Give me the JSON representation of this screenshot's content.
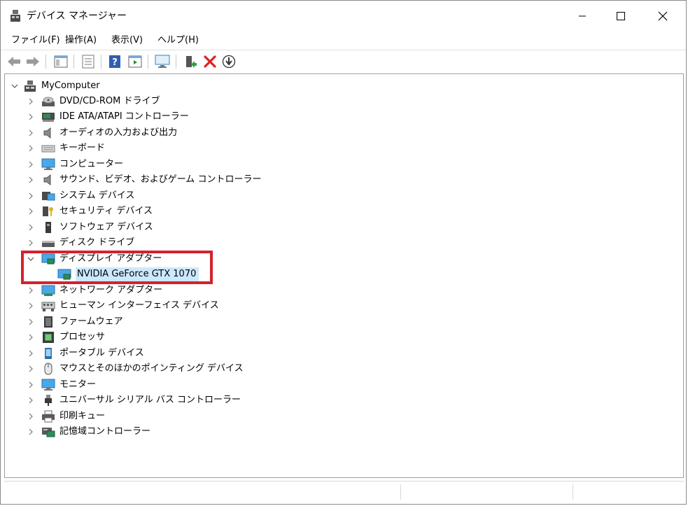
{
  "window": {
    "title": "デバイス マネージャー",
    "controls": {
      "minimize": "minimize",
      "maximize": "maximize",
      "close": "close"
    }
  },
  "menu": [
    {
      "id": "file",
      "label": "ファイル(F)"
    },
    {
      "id": "action",
      "label": "操作(A)"
    },
    {
      "id": "view",
      "label": "表示(V)"
    },
    {
      "id": "help",
      "label": "ヘルプ(H)"
    }
  ],
  "toolbar": [
    "back-arrow-icon",
    "forward-arrow-icon",
    "show-hide-console-tree-icon",
    "properties-icon",
    "help-icon",
    "show-action-pane-icon",
    "scan-hardware-icon",
    "update-driver-icon",
    "uninstall-icon",
    "enable-disable-icon"
  ],
  "tree": {
    "root": "MyComputer",
    "categories": [
      {
        "label": "DVD/CD-ROM ドライブ",
        "icon": "dvd-drive-icon"
      },
      {
        "label": "IDE ATA/ATAPI コントローラー",
        "icon": "ide-controller-icon"
      },
      {
        "label": "オーディオの入力および出力",
        "icon": "speaker-icon"
      },
      {
        "label": "キーボード",
        "icon": "keyboard-icon"
      },
      {
        "label": "コンピューター",
        "icon": "monitor-icon"
      },
      {
        "label": "サウンド、ビデオ、およびゲーム コントローラー",
        "icon": "speaker-icon"
      },
      {
        "label": "システム デバイス",
        "icon": "system-device-icon"
      },
      {
        "label": "セキュリティ デバイス",
        "icon": "security-key-icon"
      },
      {
        "label": "ソフトウェア デバイス",
        "icon": "software-device-icon"
      },
      {
        "label": "ディスク ドライブ",
        "icon": "disk-drive-icon"
      },
      {
        "label": "ディスプレイ アダプター",
        "icon": "display-adapter-icon",
        "expanded": true,
        "children": [
          {
            "label": "NVIDIA GeForce GTX 1070",
            "icon": "display-adapter-icon",
            "selected": true
          }
        ]
      },
      {
        "label": "ネットワーク アダプター",
        "icon": "network-adapter-icon"
      },
      {
        "label": "ヒューマン インターフェイス デバイス",
        "icon": "hid-icon"
      },
      {
        "label": "ファームウェア",
        "icon": "firmware-icon"
      },
      {
        "label": "プロセッサ",
        "icon": "processor-icon"
      },
      {
        "label": "ポータブル デバイス",
        "icon": "portable-device-icon"
      },
      {
        "label": "マウスとそのほかのポインティング デバイス",
        "icon": "mouse-icon"
      },
      {
        "label": "モニター",
        "icon": "monitor-icon"
      },
      {
        "label": "ユニバーサル シリアル バス コントローラー",
        "icon": "usb-icon"
      },
      {
        "label": "印刷キュー",
        "icon": "printer-icon"
      },
      {
        "label": "記憶域コントローラー",
        "icon": "storage-controller-icon"
      }
    ]
  },
  "colors": {
    "highlight": "#d4222b",
    "selection": "#cce8ff",
    "accent_blue": "#1e7fd6",
    "uninstall_red": "#e02020"
  }
}
